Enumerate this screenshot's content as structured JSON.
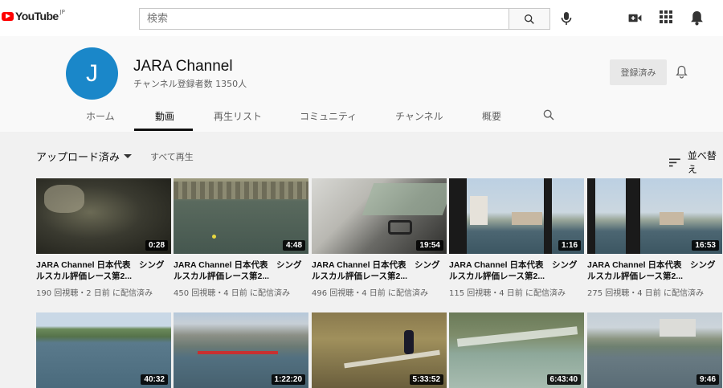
{
  "header": {
    "logo_text": "YouTube",
    "logo_region": "JP",
    "search_placeholder": "検索",
    "icons": [
      "search-icon",
      "mic-icon",
      "create-video-icon",
      "apps-grid-icon",
      "notifications-bell-icon"
    ]
  },
  "channel": {
    "avatar_letter": "J",
    "avatar_color": "#1a87c9",
    "name": "JARA Channel",
    "subscribers": "チャンネル登録者数 1350人",
    "subscribe_label": "登録済み"
  },
  "tabs": [
    {
      "label": "ホーム"
    },
    {
      "label": "動画",
      "active": true
    },
    {
      "label": "再生リスト"
    },
    {
      "label": "コミュニティ"
    },
    {
      "label": "チャンネル"
    },
    {
      "label": "概要"
    }
  ],
  "filter": {
    "uploads_label": "アップロード済み",
    "play_all_label": "すべて再生",
    "sort_label": "並べ替え"
  },
  "videos": [
    {
      "title": "JARA Channel 日本代表　シングルスカル評価レース第2...",
      "meta": "190 回視聴・2 日前 に配信済み",
      "duration": "0:28"
    },
    {
      "title": "JARA Channel 日本代表　シングルスカル評価レース第2...",
      "meta": "450 回視聴・4 日前 に配信済み",
      "duration": "4:48"
    },
    {
      "title": "JARA Channel 日本代表　シングルスカル評価レース第2...",
      "meta": "496 回視聴・4 日前 に配信済み",
      "duration": "19:54"
    },
    {
      "title": "JARA Channel 日本代表　シングルスカル評価レース第2...",
      "meta": "115 回視聴・4 日前 に配信済み",
      "duration": "1:16"
    },
    {
      "title": "JARA Channel 日本代表　シングルスカル評価レース第2...",
      "meta": "275 回視聴・4 日前 に配信済み",
      "duration": "16:53"
    },
    {
      "title": "",
      "meta": "",
      "duration": "40:32"
    },
    {
      "title": "",
      "meta": "",
      "duration": "1:22:20"
    },
    {
      "title": "",
      "meta": "",
      "duration": "5:33:52"
    },
    {
      "title": "",
      "meta": "",
      "duration": "6:43:40"
    },
    {
      "title": "",
      "meta": "",
      "duration": "9:46"
    }
  ]
}
